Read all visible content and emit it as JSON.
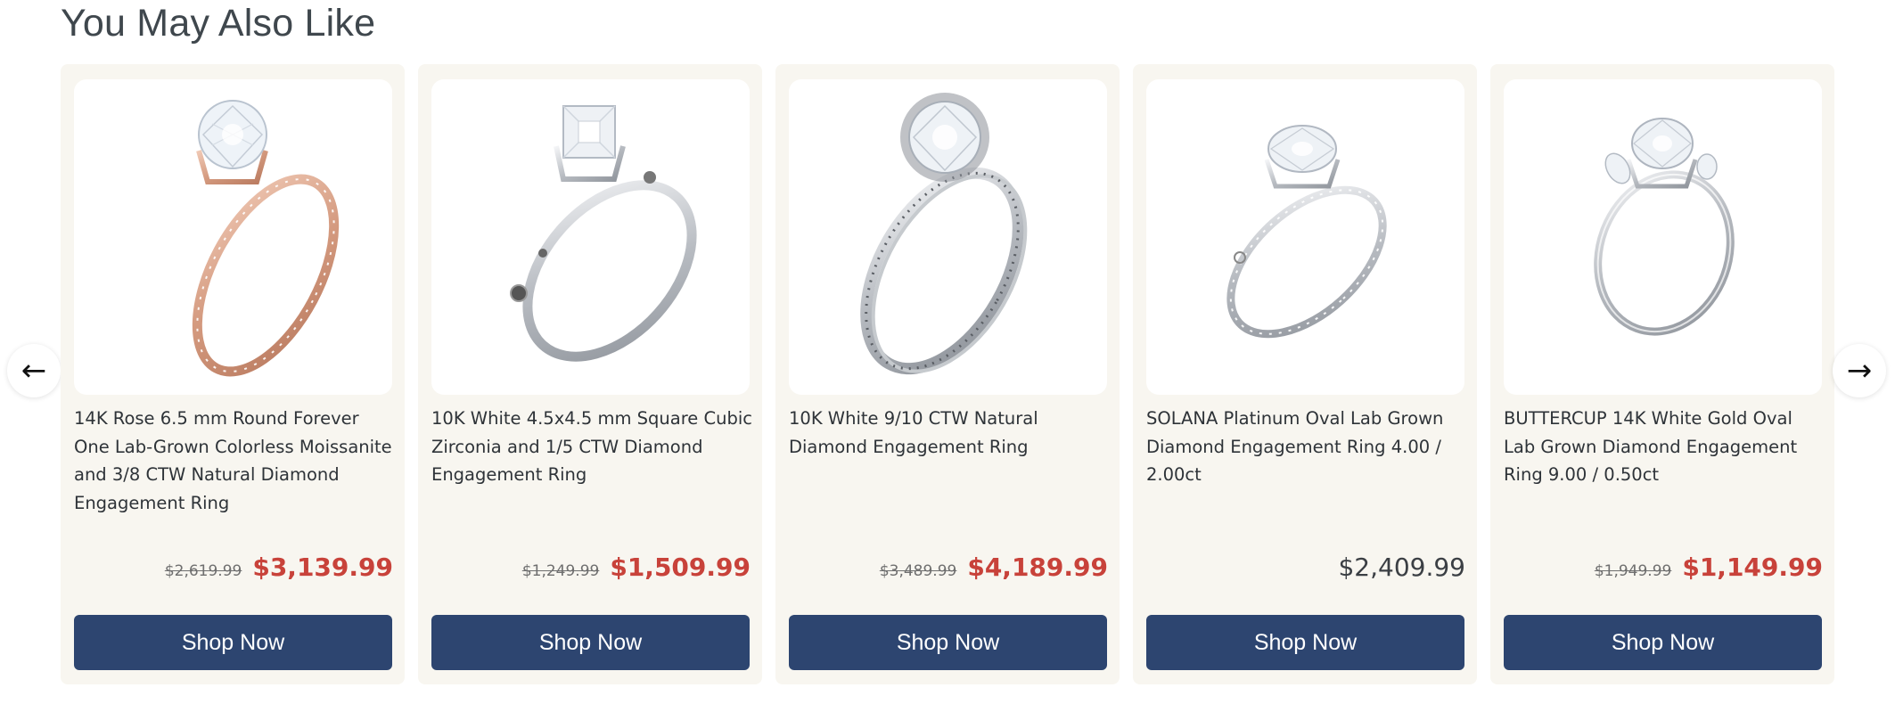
{
  "section": {
    "title": "You May Also Like"
  },
  "nav": {
    "prev_icon": "←",
    "next_icon": "→"
  },
  "colors": {
    "card_bg": "#f8f6f0",
    "button_bg": "#2d4570",
    "sale_price": "#c8423a",
    "rose_gold": "#d49a7f",
    "white_gold": "#c9ccd1"
  },
  "products": [
    {
      "name": "14K Rose 6.5 mm Round Forever One Lab-Grown Colorless Moissanite and 3/8 CTW Natural Diamond Engagement Ring",
      "old_price": "$2,619.99",
      "price": "$3,139.99",
      "on_sale": true,
      "button": "Shop Now",
      "image": "rose-gold-solitaire-ring-image",
      "metal": "rose"
    },
    {
      "name": "10K White 4.5x4.5 mm Square Cubic Zirconia and 1/5 CTW Diamond Engagement Ring",
      "old_price": "$1,249.99",
      "price": "$1,509.99",
      "on_sale": true,
      "button": "Shop Now",
      "image": "white-gold-princess-ring-image",
      "metal": "white"
    },
    {
      "name": "10K White 9/10 CTW Natural Diamond Engagement Ring",
      "old_price": "$3,489.99",
      "price": "$4,189.99",
      "on_sale": true,
      "button": "Shop Now",
      "image": "white-gold-halo-ring-image",
      "metal": "white"
    },
    {
      "name": "SOLANA Platinum Oval Lab Grown Diamond Engagement Ring 4.00 / 2.00ct",
      "old_price": "",
      "price": "$2,409.99",
      "on_sale": false,
      "button": "Shop Now",
      "image": "platinum-oval-ring-image",
      "metal": "white"
    },
    {
      "name": "BUTTERCUP 14K White Gold Oval Lab Grown Diamond Engagement Ring 9.00 / 0.50ct",
      "old_price": "$1,949.99",
      "price": "$1,149.99",
      "on_sale": true,
      "button": "Shop Now",
      "image": "white-gold-three-stone-ring-image",
      "metal": "white"
    }
  ]
}
